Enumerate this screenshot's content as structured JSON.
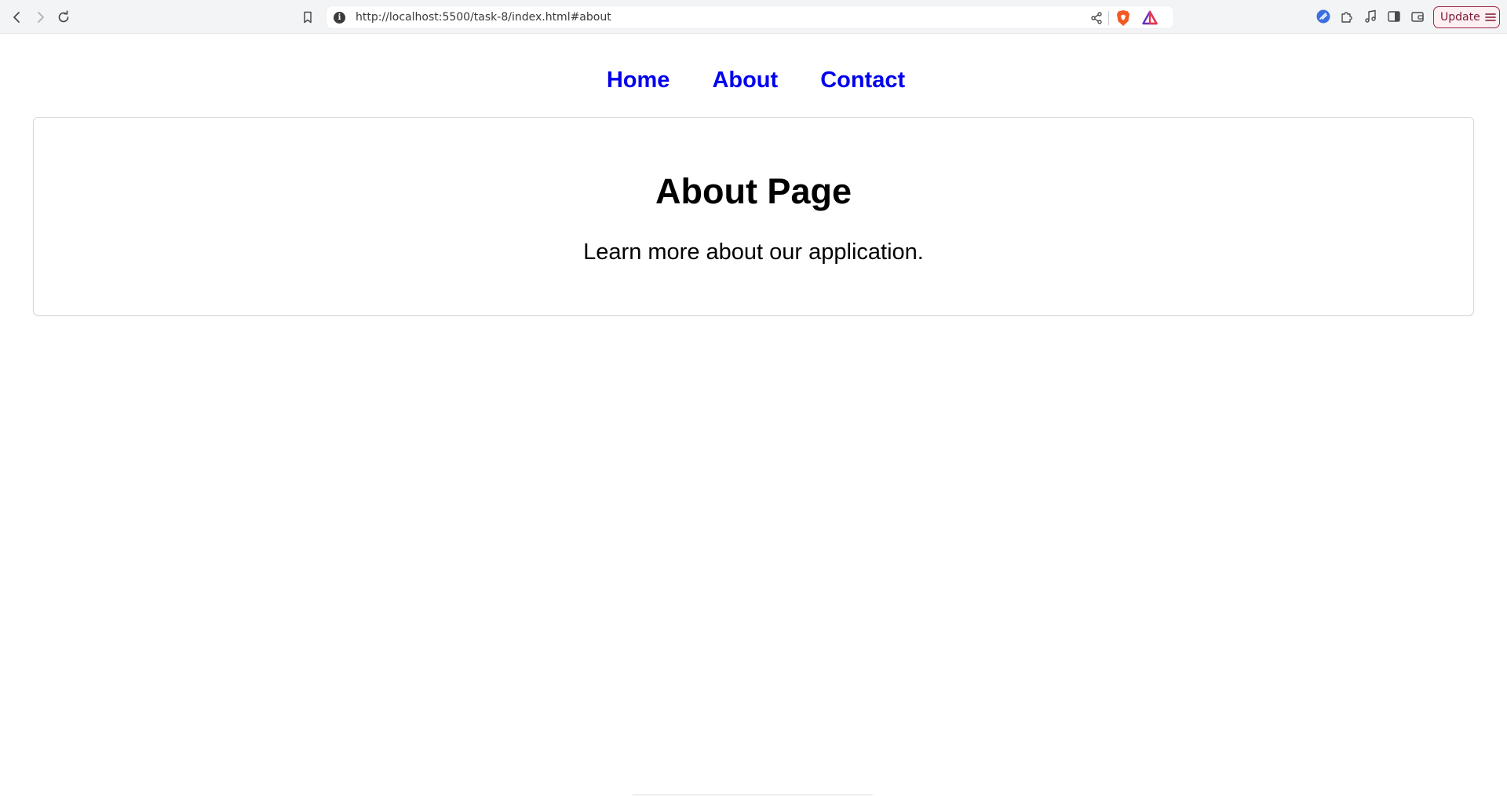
{
  "browser": {
    "url": "http://localhost:5500/task-8/index.html#about",
    "info_icon": "i",
    "update_label": "Update",
    "icons": [
      "back-icon",
      "forward-icon",
      "reload-icon",
      "bookmark-icon",
      "info-icon",
      "share-icon",
      "brave-shield-icon",
      "brave-rewards-icon",
      "leo-ai-icon",
      "extensions-icon",
      "media-icon",
      "sidebar-icon",
      "wallet-icon",
      "menu-icon"
    ]
  },
  "nav": {
    "home": "Home",
    "about": "About",
    "contact": "Contact",
    "link_color": "#0000ee"
  },
  "content": {
    "title": "About Page",
    "text": "Learn more about our application."
  }
}
